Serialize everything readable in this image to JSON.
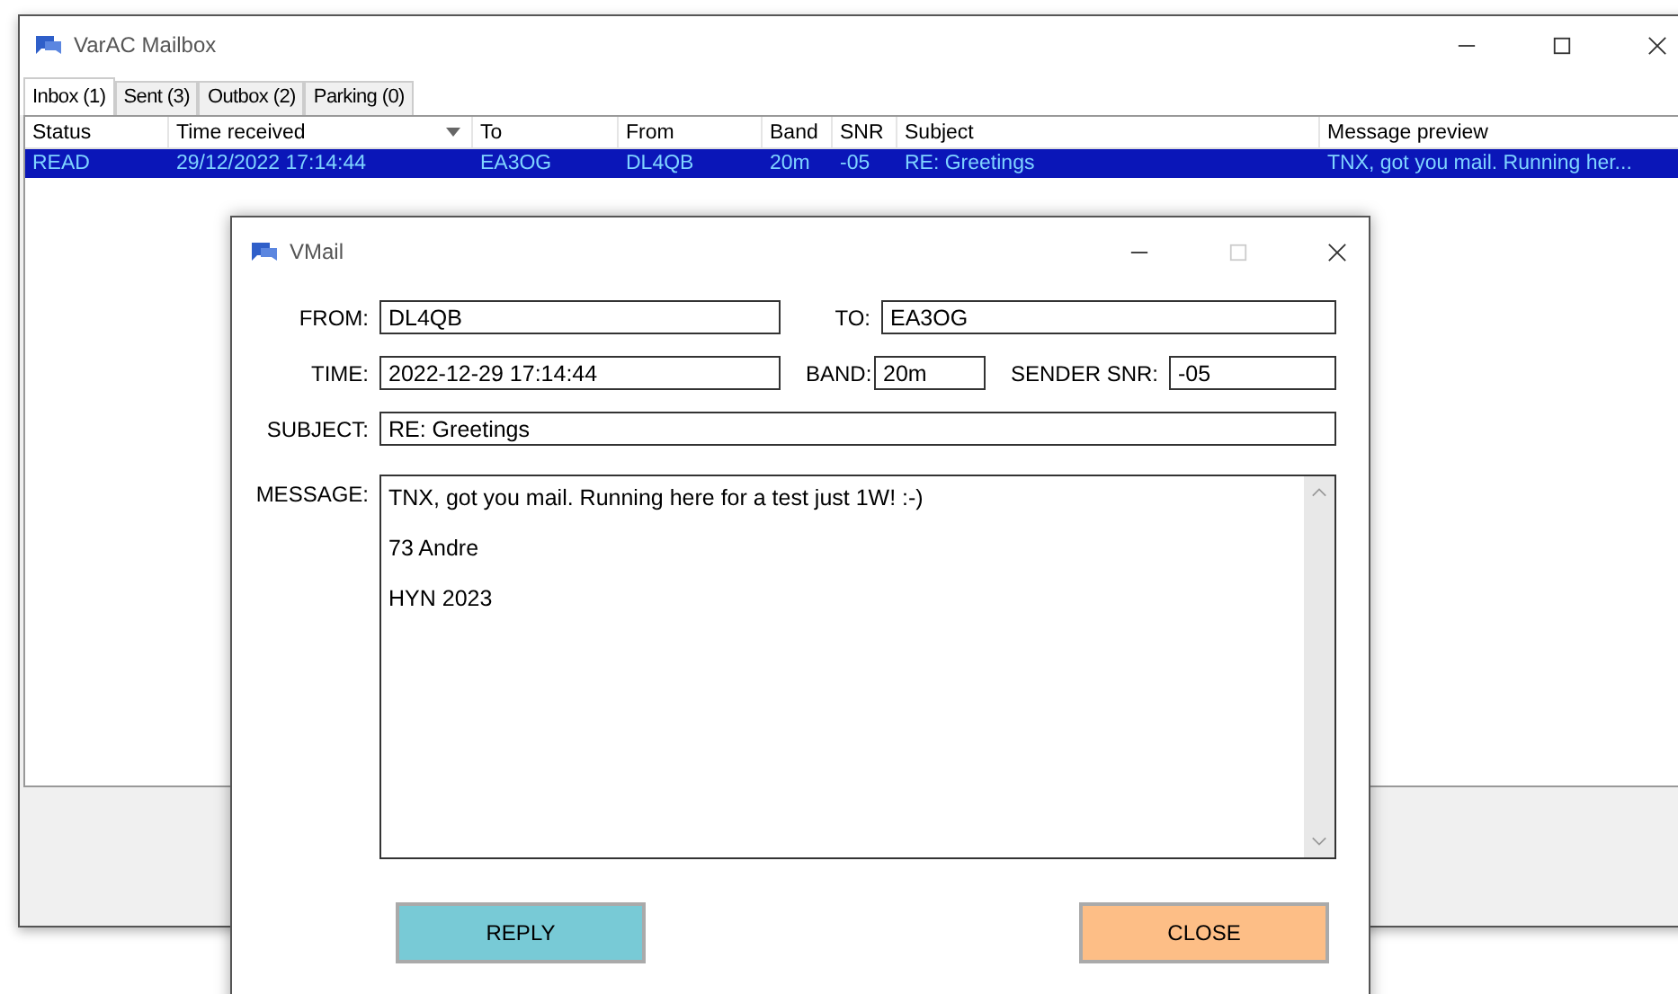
{
  "window": {
    "title": "VarAC Mailbox"
  },
  "tabs": [
    {
      "label": "Inbox (1)",
      "selected": true
    },
    {
      "label": "Sent (3)",
      "selected": false
    },
    {
      "label": "Outbox (2)",
      "selected": false
    },
    {
      "label": "Parking (0)",
      "selected": false
    }
  ],
  "table": {
    "columns": [
      {
        "label": "Status",
        "sorted": false
      },
      {
        "label": "Time received",
        "sorted": true
      },
      {
        "label": "To",
        "sorted": false
      },
      {
        "label": "From",
        "sorted": false
      },
      {
        "label": "Band",
        "sorted": false
      },
      {
        "label": "SNR",
        "sorted": false
      },
      {
        "label": "Subject",
        "sorted": false
      },
      {
        "label": "Message preview",
        "sorted": false
      }
    ],
    "rows": [
      {
        "selected": true,
        "cells": [
          "READ",
          "29/12/2022 17:14:44",
          "EA3OG",
          "DL4QB",
          "20m",
          "-05",
          "RE: Greetings",
          "TNX, got you mail. Running her..."
        ]
      }
    ]
  },
  "dialog": {
    "title": "VMail",
    "from": {
      "label": "FROM:",
      "value": "DL4QB"
    },
    "to": {
      "label": "TO:",
      "value": "EA3OG"
    },
    "time": {
      "label": "TIME:",
      "value": "2022-12-29 17:14:44"
    },
    "band": {
      "label": "BAND:",
      "value": "20m"
    },
    "snr": {
      "label": "SENDER SNR:",
      "value": "-05"
    },
    "subject": {
      "label": "SUBJECT:",
      "value": "RE: Greetings"
    },
    "message": {
      "label": "MESSAGE:",
      "lines": [
        "TNX, got you mail. Running here for a test just 1W! :-)",
        "73 Andre",
        "HYN 2023"
      ]
    },
    "buttons": [
      {
        "label": "REPLY",
        "kind": "reply"
      },
      {
        "label": "CLOSE",
        "kind": "close"
      }
    ]
  }
}
